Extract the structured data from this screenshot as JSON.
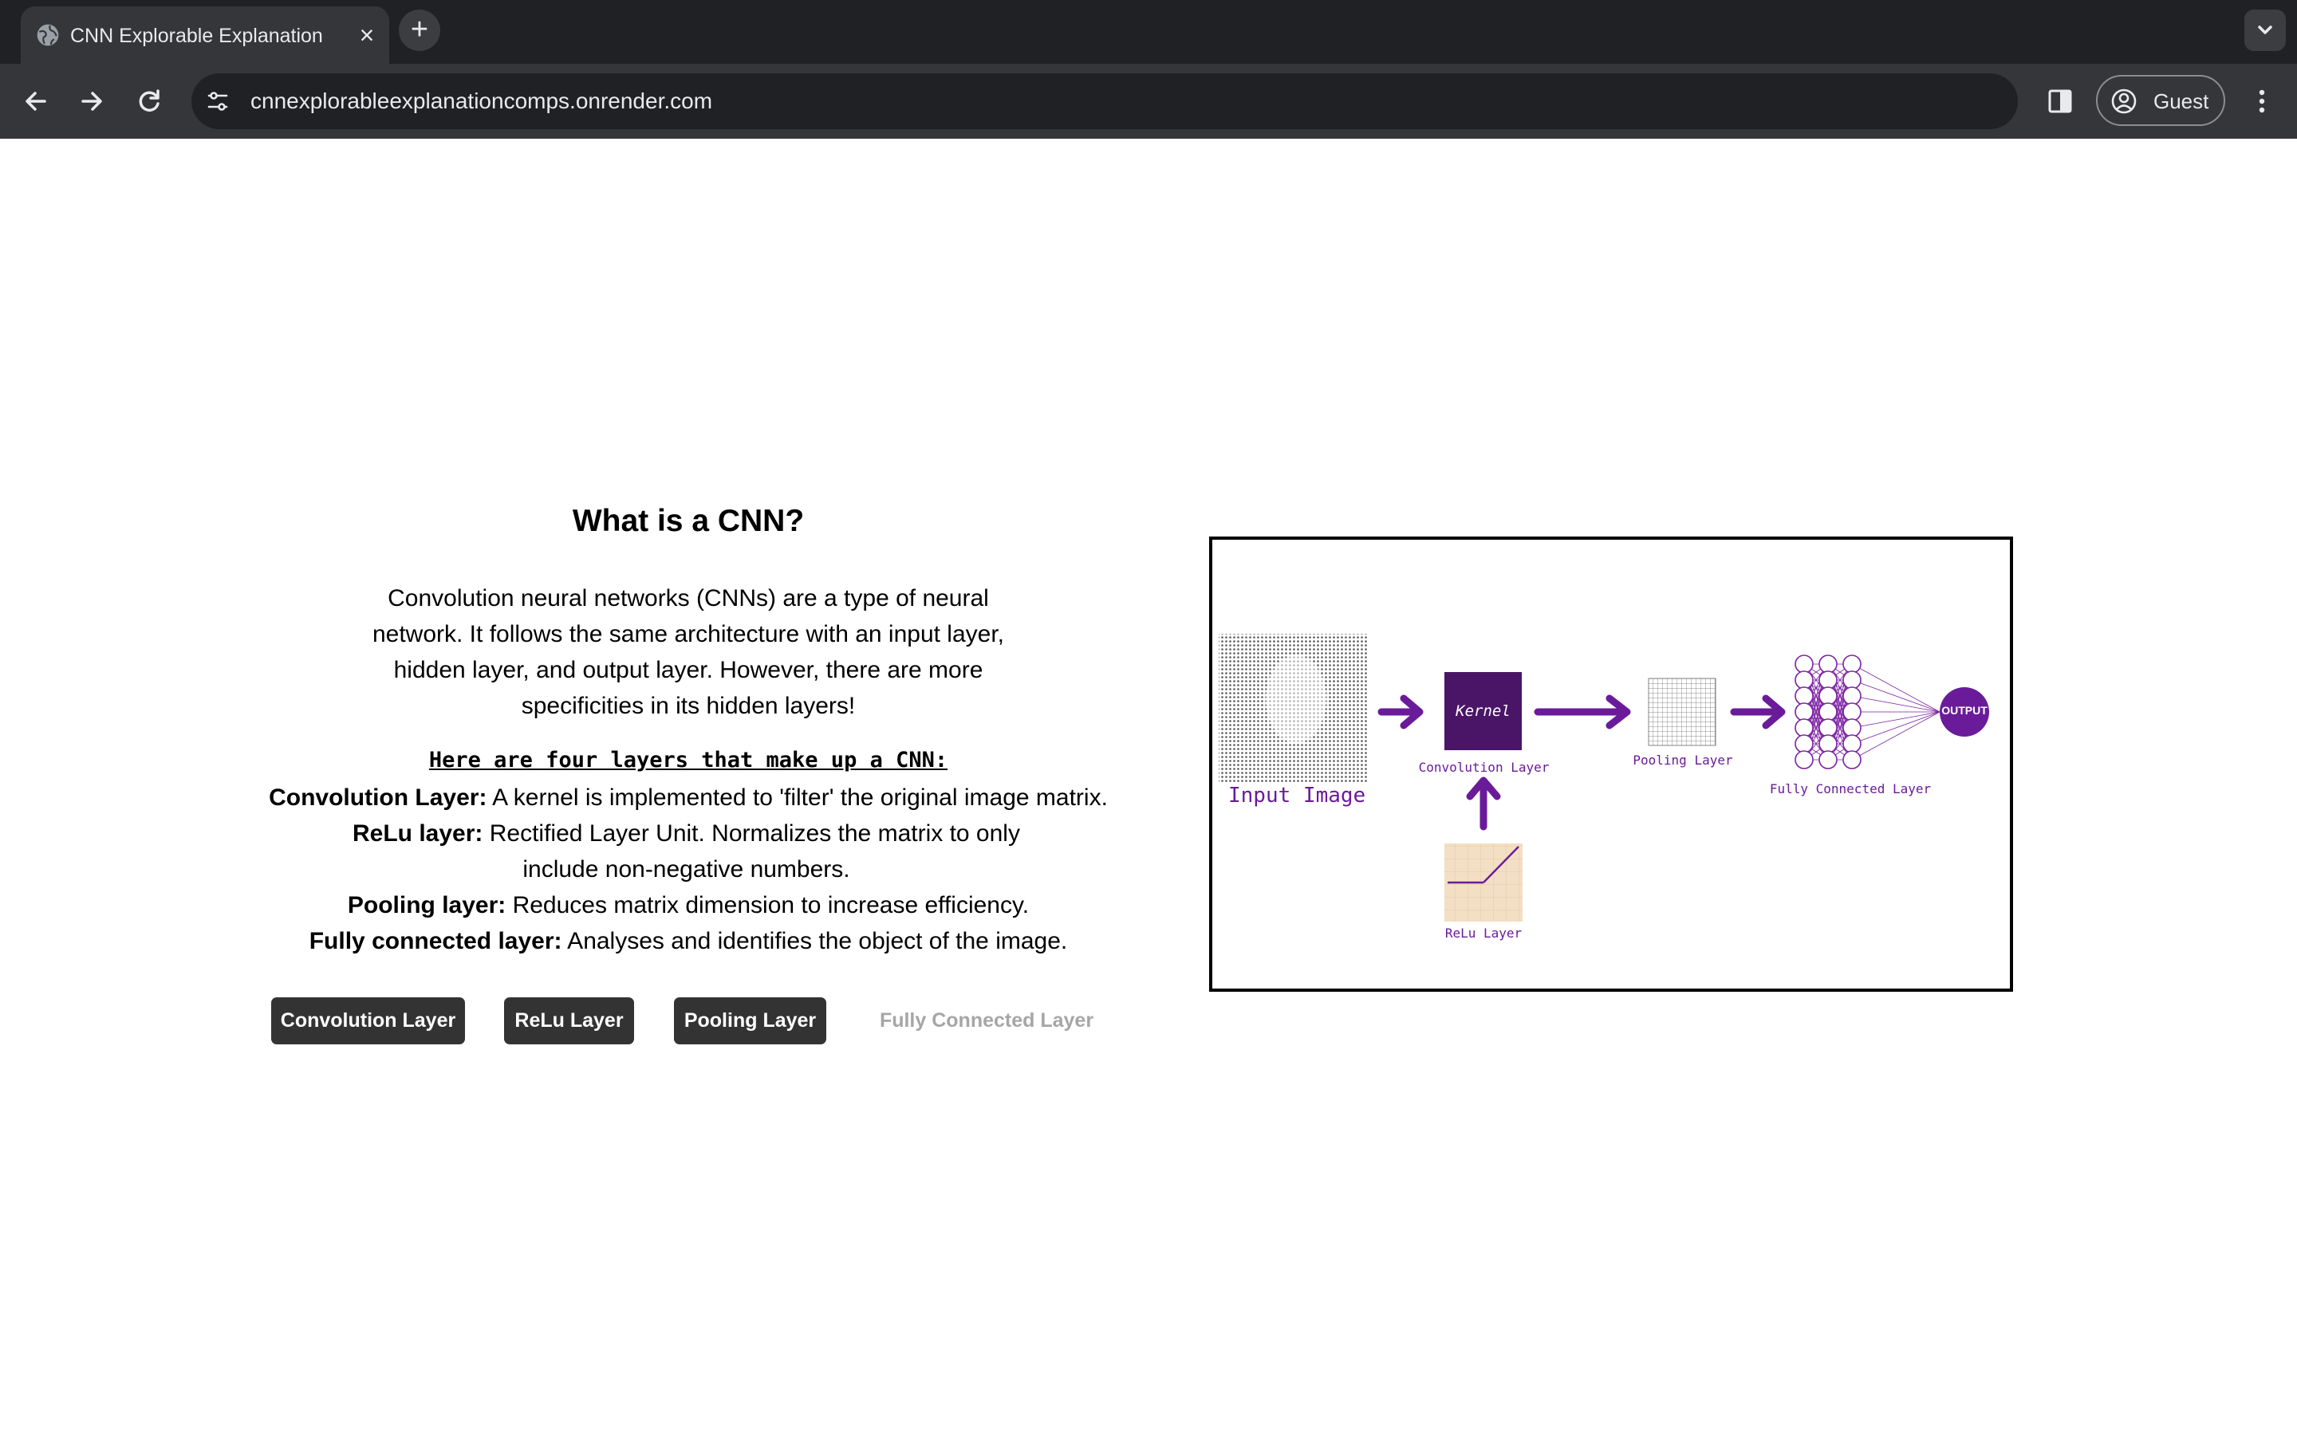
{
  "browser": {
    "tab_title": "CNN Explorable Explanation",
    "url": "cnnexplorableexplanationcomps.onrender.com",
    "profile_label": "Guest",
    "icons": [
      "globe-icon",
      "close-icon",
      "plus-icon",
      "chevron-down-icon",
      "back-arrow-icon",
      "forward-arrow-icon",
      "reload-icon",
      "site-settings-icon",
      "side-panel-icon",
      "profile-icon",
      "more-vert-icon"
    ]
  },
  "page": {
    "heading": "What is a CNN?",
    "intro": "Convolution neural networks (CNNs) are a type of neural network. It follows the same architecture with an input layer, hidden layer, and output layer. However, there are more specificities in its hidden layers!",
    "layers_heading": "Here are four layers that make up a CNN:",
    "layers": [
      {
        "term": "Convolution Layer:",
        "desc": " A kernel is implemented to 'filter' the original image matrix."
      },
      {
        "term": "ReLu layer:",
        "desc": " Rectified Layer Unit. Normalizes the matrix to only include non-negative numbers."
      },
      {
        "term": "Pooling layer:",
        "desc": " Reduces matrix dimension to increase efficiency."
      },
      {
        "term": "Fully connected layer:",
        "desc": " Analyses and identifies the object of the image."
      }
    ],
    "buttons": [
      "Convolution Layer",
      "ReLu Layer",
      "Pooling Layer",
      "Fully Connected Layer"
    ]
  },
  "diagram": {
    "input_label": "Input Image",
    "kernel_label": "Kernel",
    "convolution_label": "Convolution Layer",
    "pooling_label": "Pooling Layer",
    "fully_connected_label": "Fully Connected Layer",
    "relu_label": "ReLu Layer",
    "output_label": "OUTPUT",
    "colors": {
      "accent": "#6a1b9a",
      "kernel": "#4a1566",
      "relu_bg": "#f3dfc4"
    }
  }
}
